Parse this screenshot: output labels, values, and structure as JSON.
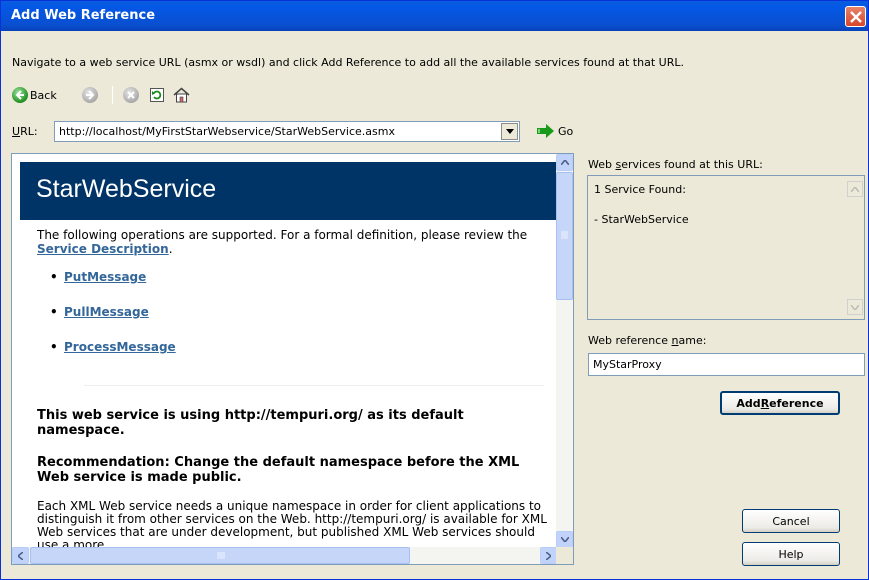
{
  "window": {
    "title": "Add Web Reference"
  },
  "instructions": "Navigate to a web service URL (asmx or wsdl) and click Add Reference to add all the available services found at that URL.",
  "toolbar": {
    "back_label": "Back"
  },
  "url_bar": {
    "label_prefix": "",
    "label_access": "U",
    "label_rest": "RL:",
    "value": "http://localhost/MyFirstStarWebservice/StarWebService.asmx",
    "go_label": "Go"
  },
  "browser": {
    "service_title": "StarWebService",
    "intro_before": "The following operations are supported. For a formal definition, please review the ",
    "intro_link": "Service Description",
    "intro_after": ".",
    "operations": [
      "PutMessage",
      "PullMessage",
      "ProcessMessage"
    ],
    "namespace_heading": "This web service is using http://tempuri.org/ as its default namespace.",
    "recommendation_heading": "Recommendation: Change the default namespace before the XML Web service is made public.",
    "body_paragraph": "Each XML Web service needs a unique namespace in order for client applications to distinguish it from other services on the Web. http://tempuri.org/ is available for XML Web services that are under development, but published XML Web services should use a more"
  },
  "services_panel": {
    "label_prefix": "Web ",
    "label_access": "s",
    "label_rest": "ervices found at this URL:",
    "count_text": "1 Service Found:",
    "service_item": "- StarWebService"
  },
  "reference_name": {
    "label_prefix": "Web reference ",
    "label_access": "n",
    "label_rest": "ame:",
    "value": "MyStarProxy"
  },
  "buttons": {
    "add_prefix": "Add ",
    "add_access": "R",
    "add_rest": "eference",
    "cancel": "Cancel",
    "help": "Help"
  },
  "colors": {
    "titlebar": "#0a5ddc",
    "header_bg": "#003366",
    "link": "#336699",
    "go_icon": "#1a9a1a"
  }
}
